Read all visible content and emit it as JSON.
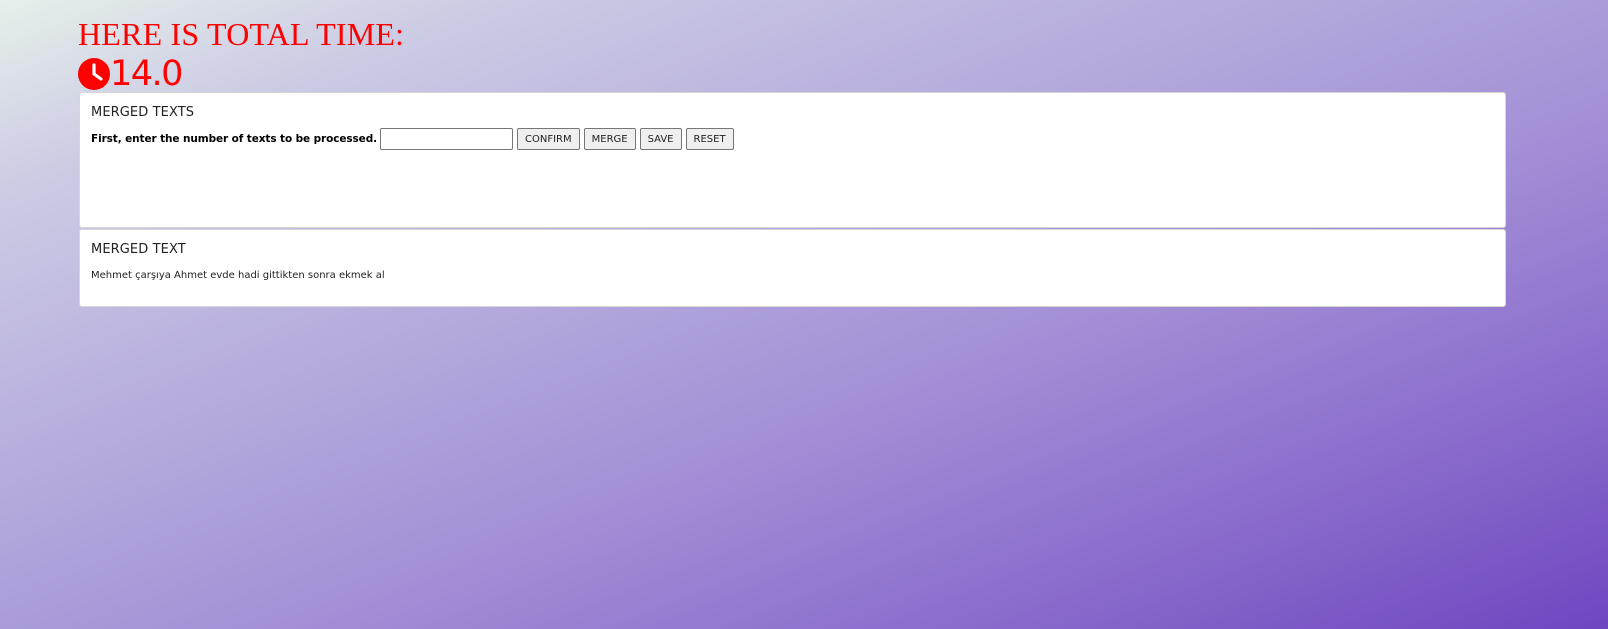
{
  "header": {
    "title": "HERE IS TOTAL TIME:",
    "timer_value": "14.0"
  },
  "icons": {
    "timer": "clock-icon"
  },
  "colors": {
    "accent": "#ff0000",
    "background_start": "#e6f0ea",
    "background_end": "#6e47c0",
    "card": "#ffffff"
  },
  "merge_panel": {
    "title": "MERGED TEXTS",
    "prompt": "First, enter the number of texts to be processed.",
    "count_value": "",
    "confirm_label": "CONFIRM",
    "merge_label": "MERGE",
    "save_label": "SAVE",
    "reset_label": "RESET"
  },
  "result_panel": {
    "title": "MERGED TEXT",
    "text": "Mehmet çarşıya Ahmet evde hadi gittikten sonra ekmek al"
  }
}
